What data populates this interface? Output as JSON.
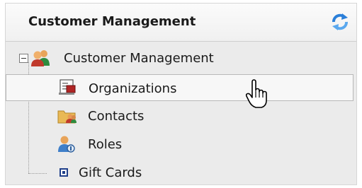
{
  "header": {
    "title": "Customer Management",
    "refresh_icon": "refresh-icon"
  },
  "tree": {
    "root": {
      "label": "Customer Management",
      "expander": "collapse",
      "icon": "customers-icon"
    },
    "items": [
      {
        "label": "Organizations",
        "icon": "organization-icon",
        "selected": true
      },
      {
        "label": "Contacts",
        "icon": "contacts-folder-icon"
      },
      {
        "label": "Roles",
        "icon": "roles-icon"
      },
      {
        "label": "Gift Cards",
        "icon": "gift-card-icon"
      }
    ]
  },
  "colors": {
    "panel_bg": "#ebebeb",
    "selection_bg": "#f7f7f7",
    "refresh_accent": "#2b7fd9"
  },
  "cursor": "hand-pointer-icon"
}
